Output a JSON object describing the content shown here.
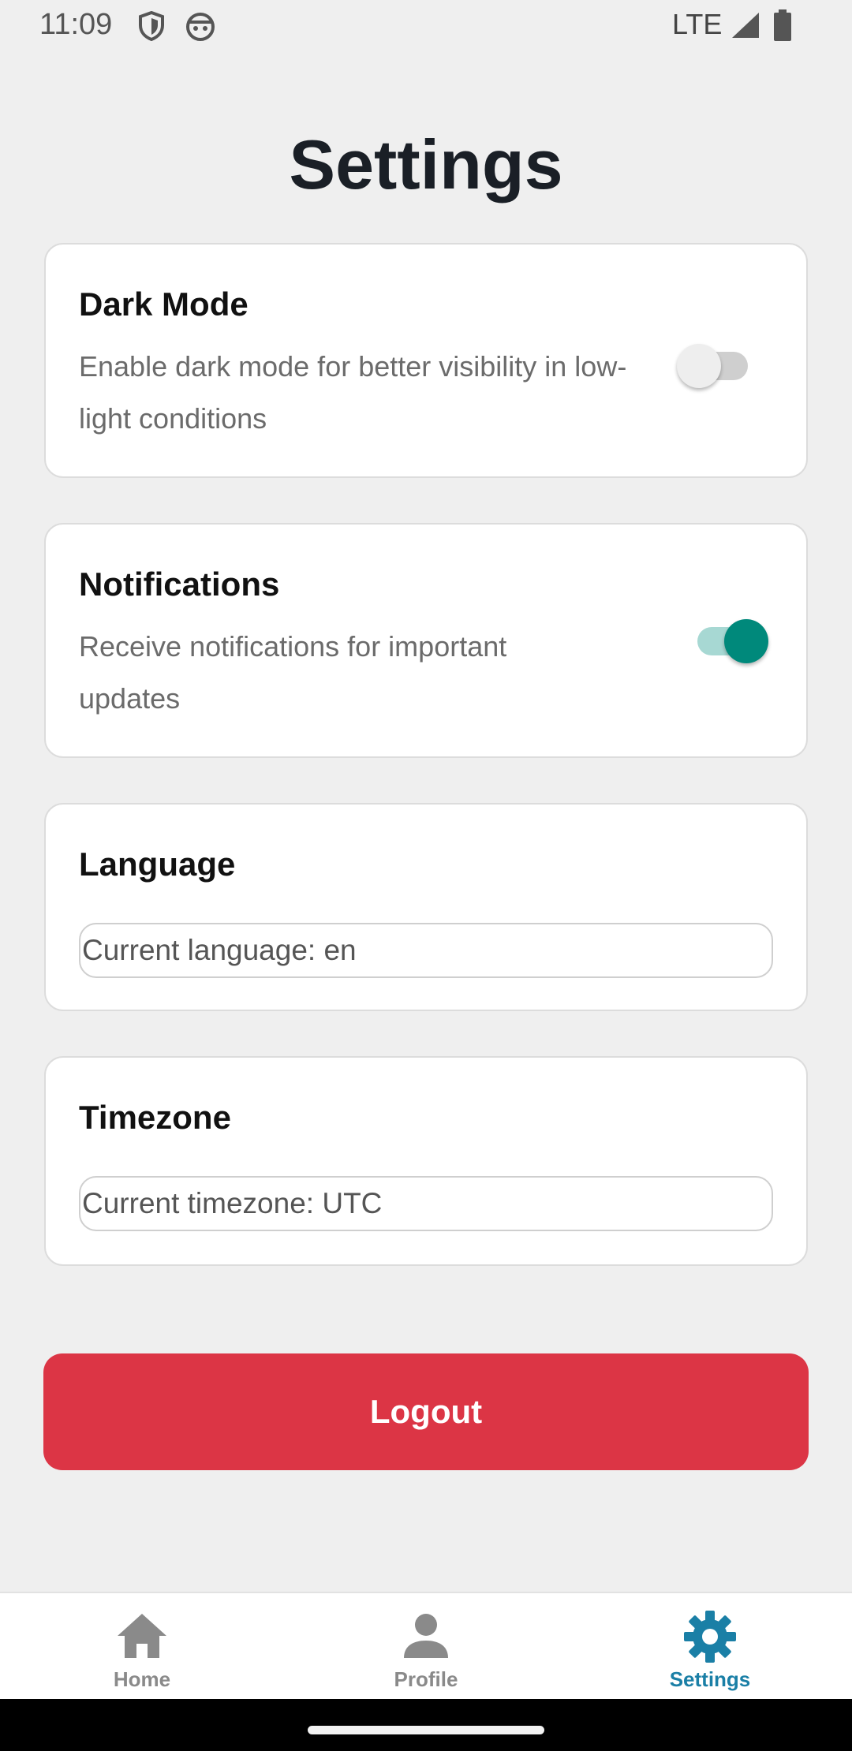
{
  "status_bar": {
    "time": "11:09",
    "network": "LTE",
    "icons": [
      "vpn-shield-icon",
      "android-robot-icon",
      "signal-icon",
      "battery-icon"
    ]
  },
  "page": {
    "title": "Settings"
  },
  "settings": {
    "dark_mode": {
      "title": "Dark Mode",
      "description": "Enable dark mode for better visibility in low-light conditions",
      "enabled": false
    },
    "notifications": {
      "title": "Notifications",
      "description": "Receive notifications for important updates",
      "enabled": true
    },
    "language": {
      "title": "Language",
      "value": "Current language: en"
    },
    "timezone": {
      "title": "Timezone",
      "value": "Current timezone: UTC"
    }
  },
  "logout": {
    "label": "Logout",
    "color": "#dc3545"
  },
  "bottom_nav": {
    "items": [
      {
        "label": "Home",
        "icon": "home-icon",
        "active": false
      },
      {
        "label": "Profile",
        "icon": "person-icon",
        "active": false
      },
      {
        "label": "Settings",
        "icon": "gear-icon",
        "active": true
      }
    ],
    "active_color": "#1a7fa6",
    "inactive_color": "#8a8a8a"
  },
  "colors": {
    "toggle_on": "#00897b",
    "background": "#efefef"
  }
}
